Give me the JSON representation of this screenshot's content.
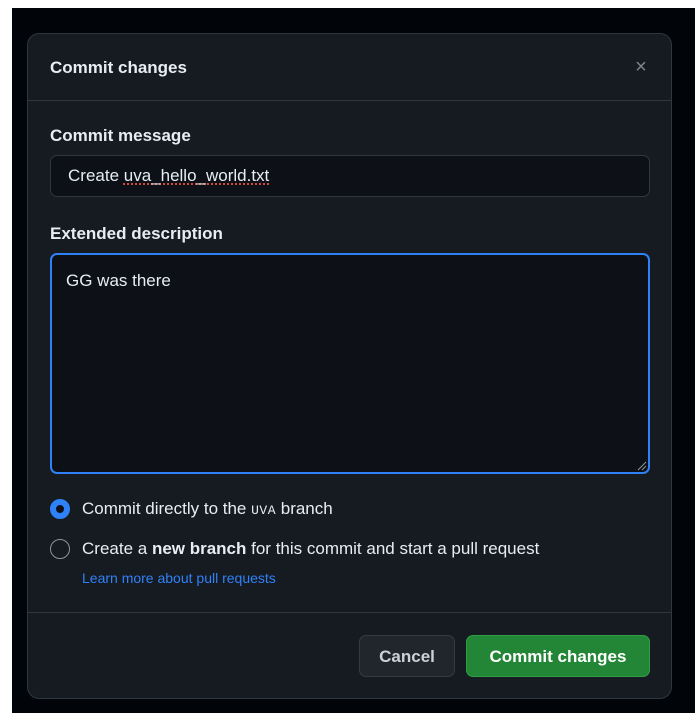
{
  "dialog": {
    "title": "Commit changes",
    "close_icon": "×"
  },
  "commit_message": {
    "label": "Commit message",
    "value_prefix": "Create ",
    "value_filename": "uva_hello_world.txt"
  },
  "extended_description": {
    "label": "Extended description",
    "value": "GG was there"
  },
  "options": {
    "direct": {
      "text_before": "Commit directly to the ",
      "branch": "UVA",
      "text_after": " branch",
      "checked": true
    },
    "new_branch": {
      "text_before": "Create a ",
      "bold": "new branch",
      "text_after": " for this commit and start a pull request",
      "checked": false
    },
    "learn_more": "Learn more about pull requests"
  },
  "footer": {
    "cancel_label": "Cancel",
    "commit_label": "Commit changes"
  },
  "colors": {
    "accent": "#2f81f7",
    "primary_button": "#238636",
    "background": "#161b22"
  }
}
